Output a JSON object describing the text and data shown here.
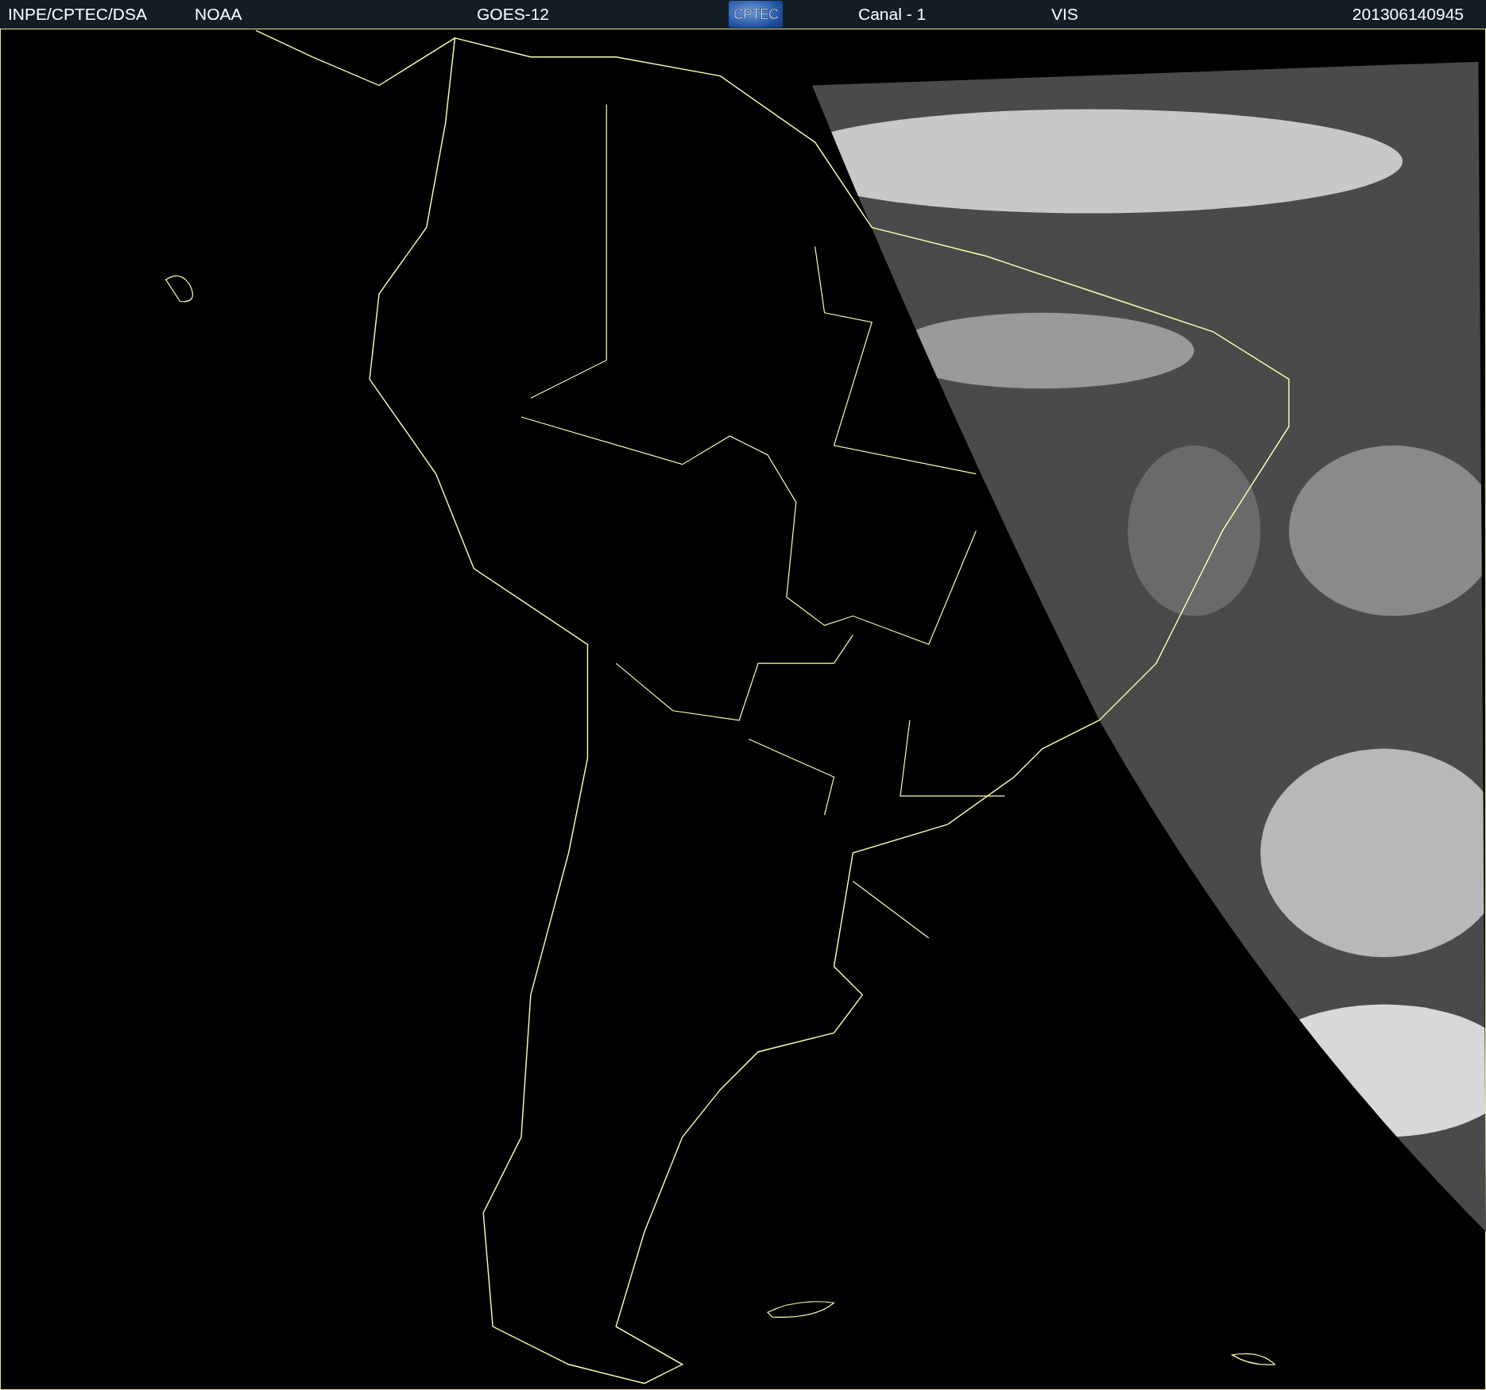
{
  "header": {
    "items": [
      {
        "kind": "text",
        "text": "INPE/CPTEC/DSA"
      },
      {
        "kind": "text",
        "text": "NOAA"
      },
      {
        "kind": "text",
        "text": "GOES-12"
      },
      {
        "kind": "logo",
        "text": "CPTEC"
      },
      {
        "kind": "text",
        "text": "Canal - 1"
      },
      {
        "kind": "text",
        "text": "VIS"
      },
      {
        "kind": "text",
        "text": "201306140945"
      }
    ]
  }
}
